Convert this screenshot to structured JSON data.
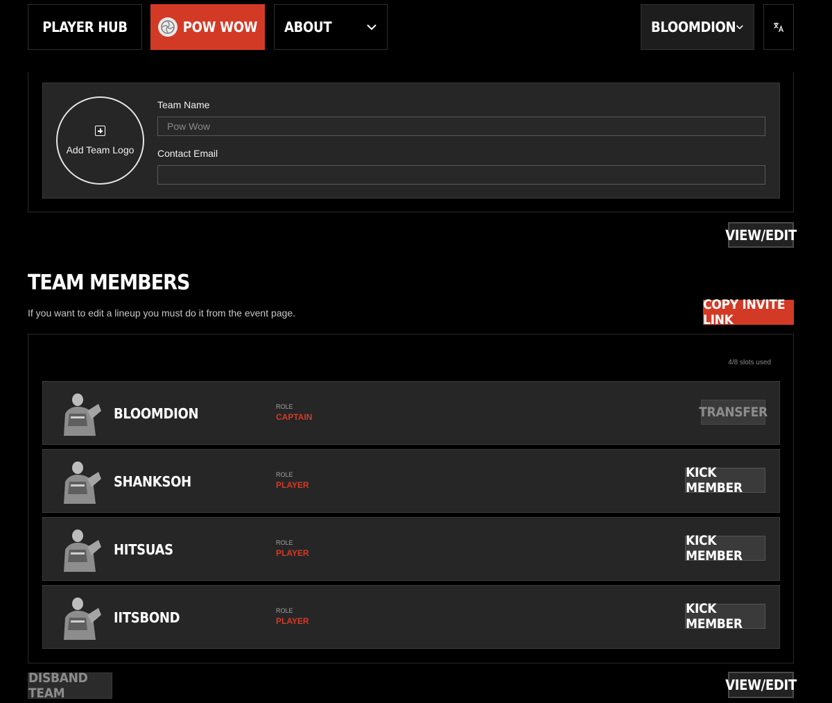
{
  "nav": {
    "player_hub": "PLAYER HUB",
    "team": "POW WOW",
    "about": "ABOUT",
    "user": "BLOOMDION",
    "language_icon": "translate-icon"
  },
  "team_info": {
    "add_logo_label": "Add Team Logo",
    "team_name_label": "Team Name",
    "team_name_value": "Pow Wow",
    "contact_email_label": "Contact Email",
    "contact_email_value": "",
    "view_edit_label": "VIEW/EDIT"
  },
  "team_members": {
    "title": "TEAM MEMBERS",
    "description": "If you want to edit a lineup you must do it from the event page.",
    "copy_invite_label": "COPY INVITE LINK",
    "slots_used": "4/8 slots used",
    "role_label": "ROLE",
    "members": [
      {
        "name": "BLOOMDION",
        "role": "CAPTAIN",
        "action": "TRANSFER"
      },
      {
        "name": "SHANKSOH",
        "role": "PLAYER",
        "action": "KICK MEMBER"
      },
      {
        "name": "HITSUAS",
        "role": "PLAYER",
        "action": "KICK MEMBER"
      },
      {
        "name": "IITSBOND",
        "role": "PLAYER",
        "action": "KICK MEMBER"
      }
    ]
  },
  "footer": {
    "disband_label": "DISBAND TEAM",
    "view_edit_label": "VIEW/EDIT"
  },
  "colors": {
    "accent": "#d33a26",
    "panel": "#262626",
    "background": "#000000"
  }
}
